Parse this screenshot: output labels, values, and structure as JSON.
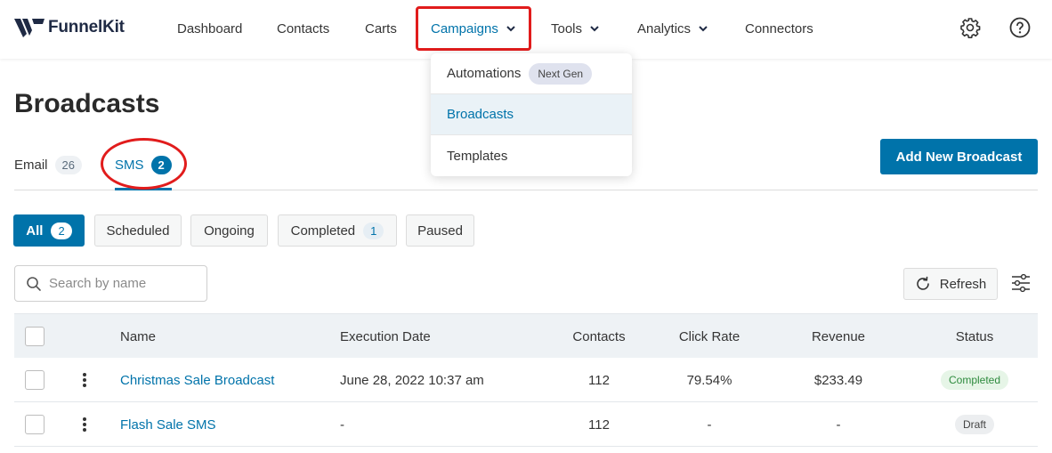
{
  "brand": {
    "name": "FunnelKit"
  },
  "nav": {
    "items": [
      {
        "label": "Dashboard"
      },
      {
        "label": "Contacts"
      },
      {
        "label": "Carts"
      },
      {
        "label": "Campaigns"
      },
      {
        "label": "Tools"
      },
      {
        "label": "Analytics"
      },
      {
        "label": "Connectors"
      }
    ],
    "icons": [
      "gear-icon",
      "help-icon"
    ]
  },
  "dropdown": {
    "items": [
      {
        "label": "Automations",
        "badge": "Next Gen"
      },
      {
        "label": "Broadcasts"
      },
      {
        "label": "Templates"
      }
    ]
  },
  "page": {
    "title": "Broadcasts",
    "add_button": "Add New Broadcast"
  },
  "channels": [
    {
      "label": "Email",
      "count": "26"
    },
    {
      "label": "SMS",
      "count": "2"
    }
  ],
  "filters": [
    {
      "label": "All",
      "count": "2"
    },
    {
      "label": "Scheduled"
    },
    {
      "label": "Ongoing"
    },
    {
      "label": "Completed",
      "count": "1"
    },
    {
      "label": "Paused"
    }
  ],
  "search": {
    "placeholder": "Search by name"
  },
  "toolbar": {
    "refresh_label": "Refresh"
  },
  "table": {
    "columns": [
      "Name",
      "Execution Date",
      "Contacts",
      "Click Rate",
      "Revenue",
      "Status"
    ],
    "rows": [
      {
        "name": "Christmas Sale Broadcast",
        "date": "June 28, 2022 10:37 am",
        "contacts": "112",
        "click_rate": "79.54%",
        "revenue": "$233.49",
        "status": "Completed"
      },
      {
        "name": "Flash Sale SMS",
        "date": "-",
        "contacts": "112",
        "click_rate": "-",
        "revenue": "-",
        "status": "Draft"
      }
    ]
  },
  "colors": {
    "accent": "#0073aa",
    "highlight": "#e11c1c",
    "completed": "#2e8b3e"
  }
}
